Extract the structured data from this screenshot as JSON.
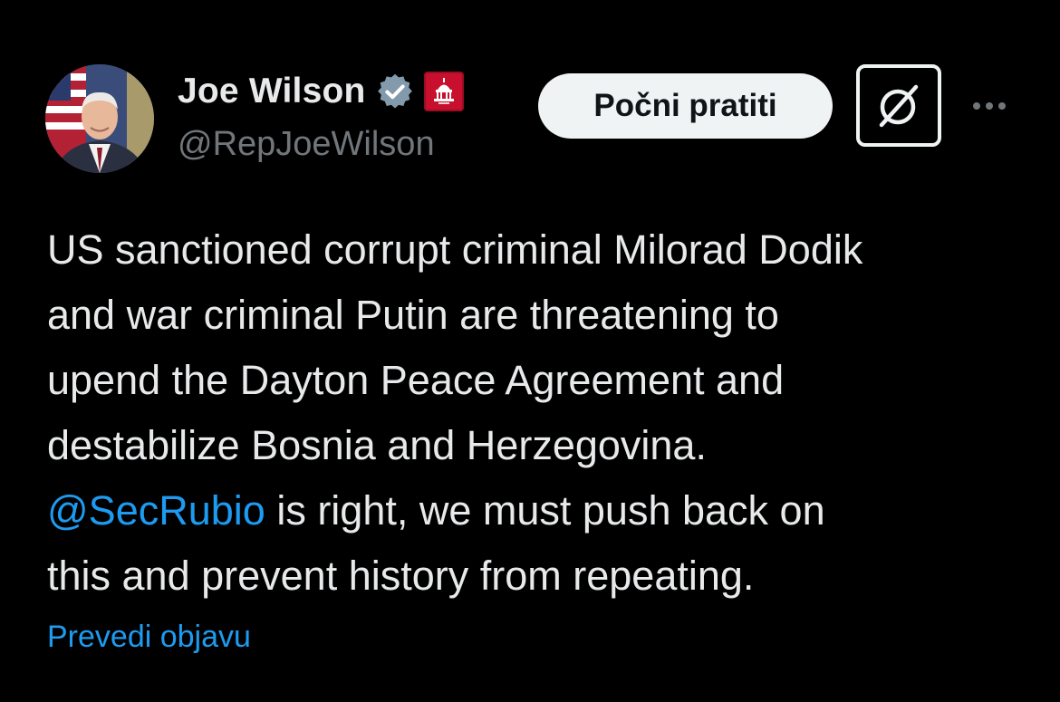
{
  "author": {
    "display_name": "Joe Wilson",
    "handle": "@RepJoeWilson",
    "avatar_icon": "portrait-avatar",
    "verified_icon": "verified-badge-icon",
    "verified_color": "#829aab",
    "affiliate_icon": "house-gop-affiliate-badge",
    "affiliate_color": "#c8102e"
  },
  "actions": {
    "follow_label": "Počni pratiti",
    "grok_icon": "grok-icon",
    "more_icon": "more-options-icon"
  },
  "tweet": {
    "lines": [
      "US sanctioned corrupt criminal Milorad Dodik",
      "and war criminal Putin are threatening to",
      "upend the Dayton Peace Agreement and",
      "destabilize Bosnia and Herzegovina."
    ],
    "mention": "@SecRubio",
    "line5_rest": " is right, we must push back on",
    "line6": "this and prevent history from repeating.",
    "translate_label": "Prevedi objavu"
  },
  "colors": {
    "background": "#000000",
    "text": "#e7e9ea",
    "secondary_text": "#71767b",
    "link": "#1d9bf0",
    "button_bg": "#eff3f4"
  }
}
